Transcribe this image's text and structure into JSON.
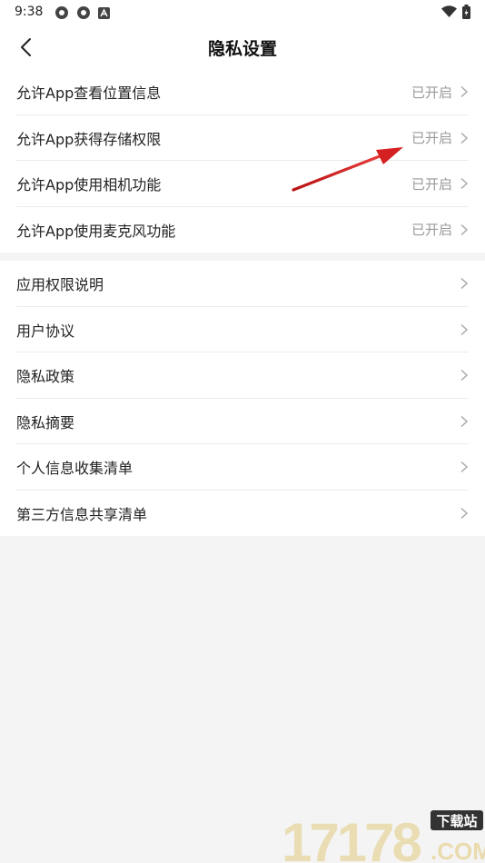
{
  "status_bar": {
    "time": "9:38"
  },
  "header": {
    "title": "隐私设置"
  },
  "permissions": [
    {
      "label": "允许App查看位置信息",
      "status": "已开启"
    },
    {
      "label": "允许App获得存储权限",
      "status": "已开启"
    },
    {
      "label": "允许App使用相机功能",
      "status": "已开启"
    },
    {
      "label": "允许App使用麦克风功能",
      "status": "已开启"
    }
  ],
  "documents": [
    {
      "label": "应用权限说明"
    },
    {
      "label": "用户协议"
    },
    {
      "label": "隐私政策"
    },
    {
      "label": "隐私摘要"
    },
    {
      "label": "个人信息收集清单"
    },
    {
      "label": "第三方信息共享清单"
    }
  ],
  "watermark": {
    "text": "17178",
    "badge": "下载站",
    "domain": ".COM"
  },
  "colors": {
    "annotation_arrow": "#d42020",
    "watermark": "#e9d9a8"
  }
}
